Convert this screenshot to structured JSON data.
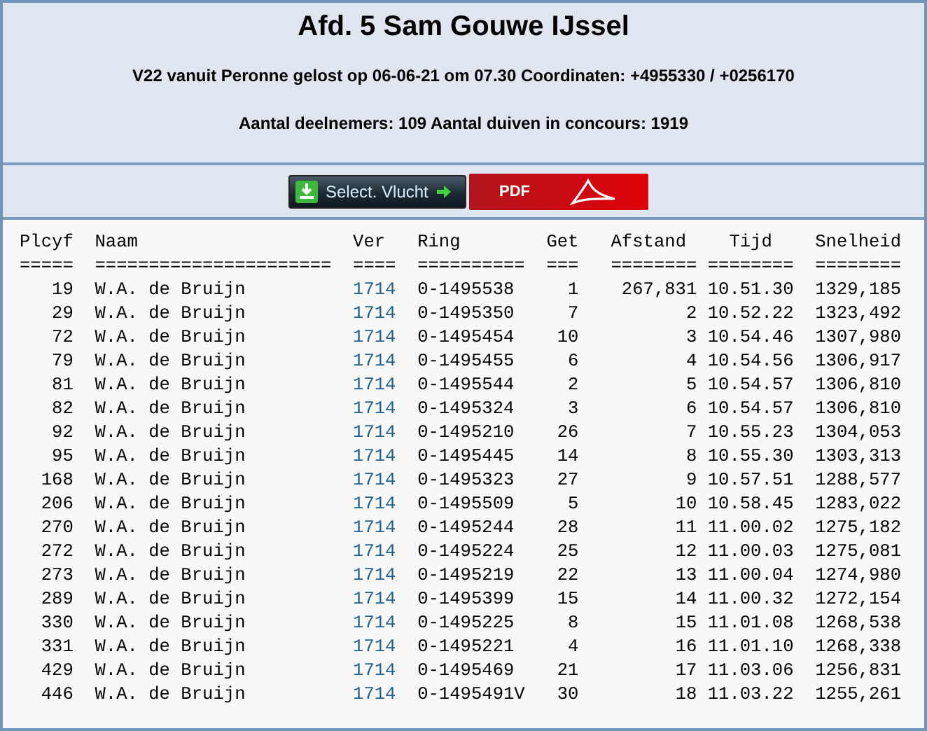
{
  "header": {
    "title": "Afd. 5 Sam Gouwe IJssel",
    "release": "V22 vanuit Peronne gelost op 06-06-21 om 07.30 Coordinaten: +4955330 / +0256170",
    "counts": "Aantal deelnemers: 109 Aantal duiven in concours: 1919"
  },
  "buttons": [
    {
      "kind": "select",
      "label": "Select. Vlucht"
    },
    {
      "kind": "pdf",
      "label": "PDF"
    }
  ],
  "table": {
    "columns": [
      {
        "label": "Plcyf",
        "separator": "====="
      },
      {
        "label": "Naam",
        "separator": "======================"
      },
      {
        "label": "Ver",
        "separator": "===="
      },
      {
        "label": "Ring",
        "separator": "=========="
      },
      {
        "label": "Get",
        "separator": "==="
      },
      {
        "label": "Afstand",
        "separator": "========"
      },
      {
        "label": "Tijd",
        "separator": "========"
      },
      {
        "label": "Snelheid",
        "separator": "========"
      }
    ],
    "rows": [
      [
        "19",
        "W.A. de Bruijn",
        "1714",
        "0-1495538",
        "1",
        "267,831",
        "10.51.30",
        "1329,185"
      ],
      [
        "29",
        "W.A. de Bruijn",
        "1714",
        "0-1495350",
        "7",
        "2",
        "10.52.22",
        "1323,492"
      ],
      [
        "72",
        "W.A. de Bruijn",
        "1714",
        "0-1495454",
        "10",
        "3",
        "10.54.46",
        "1307,980"
      ],
      [
        "79",
        "W.A. de Bruijn",
        "1714",
        "0-1495455",
        "6",
        "4",
        "10.54.56",
        "1306,917"
      ],
      [
        "81",
        "W.A. de Bruijn",
        "1714",
        "0-1495544",
        "2",
        "5",
        "10.54.57",
        "1306,810"
      ],
      [
        "82",
        "W.A. de Bruijn",
        "1714",
        "0-1495324",
        "3",
        "6",
        "10.54.57",
        "1306,810"
      ],
      [
        "92",
        "W.A. de Bruijn",
        "1714",
        "0-1495210",
        "26",
        "7",
        "10.55.23",
        "1304,053"
      ],
      [
        "95",
        "W.A. de Bruijn",
        "1714",
        "0-1495445",
        "14",
        "8",
        "10.55.30",
        "1303,313"
      ],
      [
        "168",
        "W.A. de Bruijn",
        "1714",
        "0-1495323",
        "27",
        "9",
        "10.57.51",
        "1288,577"
      ],
      [
        "206",
        "W.A. de Bruijn",
        "1714",
        "0-1495509",
        "5",
        "10",
        "10.58.45",
        "1283,022"
      ],
      [
        "270",
        "W.A. de Bruijn",
        "1714",
        "0-1495244",
        "28",
        "11",
        "11.00.02",
        "1275,182"
      ],
      [
        "272",
        "W.A. de Bruijn",
        "1714",
        "0-1495224",
        "25",
        "12",
        "11.00.03",
        "1275,081"
      ],
      [
        "273",
        "W.A. de Bruijn",
        "1714",
        "0-1495219",
        "22",
        "13",
        "11.00.04",
        "1274,980"
      ],
      [
        "289",
        "W.A. de Bruijn",
        "1714",
        "0-1495399",
        "15",
        "14",
        "11.00.32",
        "1272,154"
      ],
      [
        "330",
        "W.A. de Bruijn",
        "1714",
        "0-1495225",
        "8",
        "15",
        "11.01.08",
        "1268,538"
      ],
      [
        "331",
        "W.A. de Bruijn",
        "1714",
        "0-1495221",
        "4",
        "16",
        "11.01.10",
        "1268,338"
      ],
      [
        "429",
        "W.A. de Bruijn",
        "1714",
        "0-1495469",
        "21",
        "17",
        "11.03.06",
        "1256,831"
      ],
      [
        "446",
        "W.A. de Bruijn",
        "1714",
        "0-1495491V",
        "30",
        "18",
        "11.03.22",
        "1255,261"
      ]
    ]
  }
}
